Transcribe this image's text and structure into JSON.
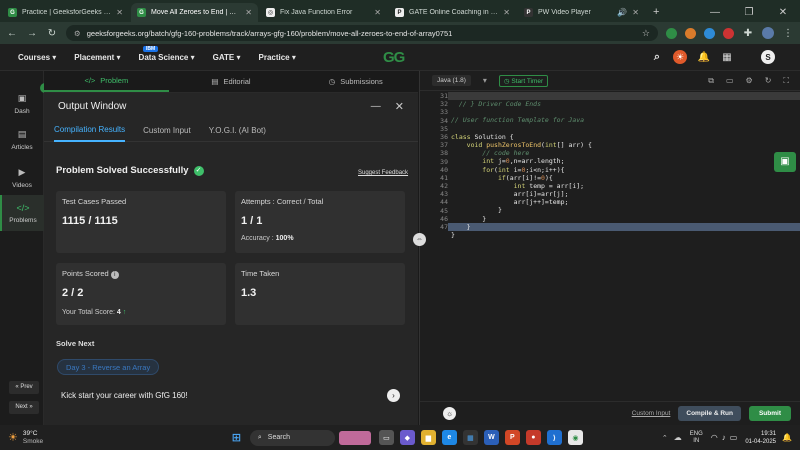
{
  "browser": {
    "tabs": [
      {
        "title": "Practice | GeeksforGeeks | A co",
        "active": false
      },
      {
        "title": "Move All Zeroes to End | Practic",
        "active": true
      },
      {
        "title": "Fix Java Function Error",
        "active": false
      },
      {
        "title": "GATE Online Coaching in India",
        "active": false
      },
      {
        "title": "PW Video Player",
        "active": false
      }
    ],
    "url": "geeksforgeeks.org/batch/gfg-160-problems/track/arrays-gfg-160/problem/move-all-zeroes-to-end-of-array0751"
  },
  "gfg_nav": {
    "items": [
      "Courses",
      "Placement",
      "Data Science",
      "GATE",
      "Practice"
    ],
    "badge": "IBM",
    "logo": "GG",
    "avatar": "S"
  },
  "sidebar": {
    "items": [
      "Dash",
      "Articles",
      "Videos",
      "Problems"
    ],
    "prev": "Prev",
    "next": "Next"
  },
  "problem_tabs": [
    "Problem",
    "Editorial",
    "Submissions"
  ],
  "output": {
    "title": "Output Window",
    "tabs": [
      "Compilation Results",
      "Custom Input",
      "Y.O.G.I. (AI Bot)"
    ],
    "status": "Problem Solved Successfully",
    "feedback": "Suggest Feedback",
    "test_cases_label": "Test Cases Passed",
    "test_cases_value": "1115 / 1115",
    "attempts_label": "Attempts : Correct / Total",
    "attempts_value": "1 / 1",
    "accuracy_label": "Accuracy :",
    "accuracy_value": "100%",
    "points_label": "Points Scored",
    "points_value": "2 / 2",
    "total_score_label": "Your Total Score:",
    "total_score_value": "4",
    "time_label": "Time Taken",
    "time_value": "1.3",
    "solve_next_label": "Solve Next",
    "solve_next_problem": "Day 3 - Reverse an Array",
    "promo": "Kick start your career with GfG 160!"
  },
  "editor": {
    "language": "Java (1.8)",
    "timer": "Start Timer",
    "line_numbers": [
      "31",
      "32",
      "33",
      "34",
      "35",
      "36",
      "37",
      "38",
      "39",
      "40",
      "41",
      "42",
      "43",
      "44",
      "45",
      "46",
      "47"
    ],
    "custom_input": "Custom Input",
    "compile_run": "Compile & Run",
    "submit": "Submit"
  },
  "taskbar": {
    "temperature": "39°C",
    "weather": "Smoke",
    "search": "Search",
    "lang": "ENG",
    "region": "IN",
    "time": "19:31",
    "date": "01-04-2025"
  },
  "colors": {
    "gfg_green": "#2f8d46",
    "accent_blue": "#46b3ff",
    "success": "#3fbf6a"
  }
}
